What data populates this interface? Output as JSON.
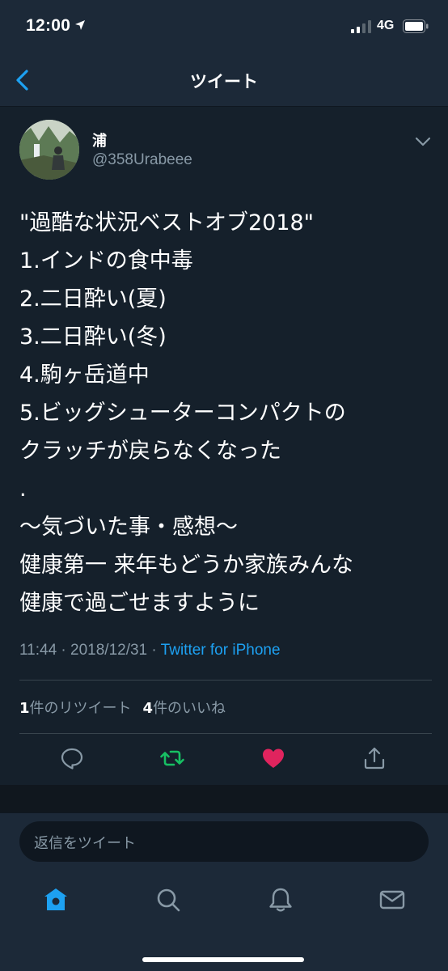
{
  "status_bar": {
    "time": "12:00",
    "network": "4G"
  },
  "nav": {
    "title": "ツイート"
  },
  "tweet": {
    "author_name": "浦",
    "author_handle": "@358Urabeee",
    "text_lines": [
      "\"過酷な状況ベストオブ2018\"",
      "1.インドの食中毒",
      "2.二日酔い(夏)",
      "3.二日酔い(冬)",
      "4.駒ヶ岳道中",
      "5.ビッグシューターコンパクトの",
      "クラッチが戻らなくなった",
      ".",
      "〜気づいた事・感想〜",
      "健康第一 来年もどうか家族みんな",
      "健康で過ごせますように"
    ],
    "time": "11:44",
    "date": "2018/12/31",
    "separator": "·",
    "source": "Twitter for iPhone",
    "retweet_count": "1",
    "retweet_label": "件のリツイート",
    "like_count": "4",
    "like_label": "件のいいね"
  },
  "actions": {
    "reply_icon": "speech-bubble-icon",
    "retweet_icon": "retweet-icon",
    "like_icon": "heart-icon",
    "share_icon": "share-icon",
    "retweet_color": "#17bf63",
    "like_color": "#e0245e"
  },
  "reply": {
    "placeholder": "返信をツイート"
  },
  "tabs": {
    "home_icon": "home-icon",
    "search_icon": "search-icon",
    "notifications_icon": "bell-icon",
    "messages_icon": "envelope-icon"
  },
  "colors": {
    "background": "#15202b",
    "accent": "#1da1f2",
    "secondary_text": "#8899a6"
  }
}
